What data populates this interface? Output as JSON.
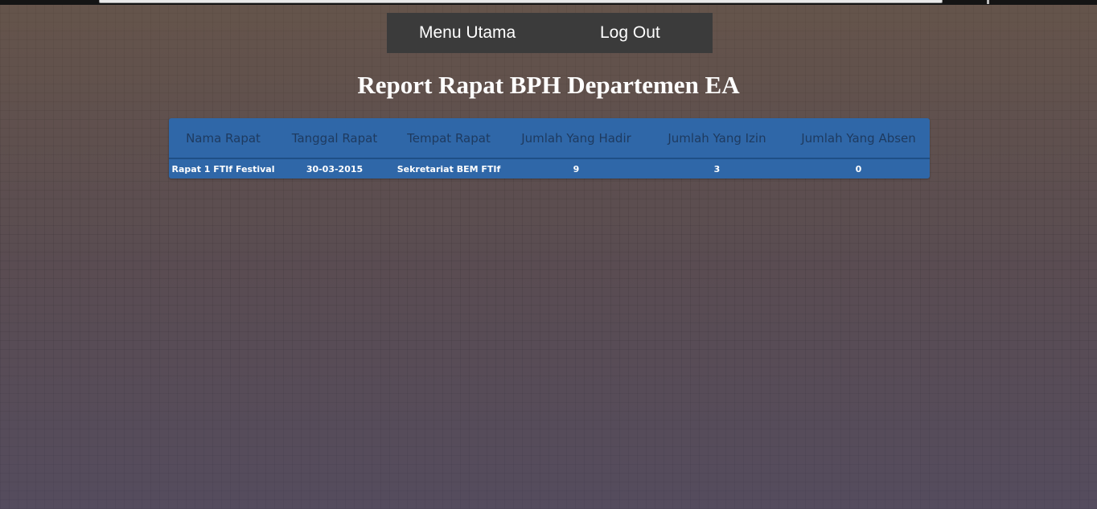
{
  "nav": {
    "menu_utama": "Menu Utama",
    "log_out": "Log Out"
  },
  "page_title": "Report Rapat BPH Departemen EA",
  "table": {
    "headers": [
      "Nama Rapat",
      "Tanggal Rapat",
      "Tempat Rapat",
      "Jumlah Yang Hadir",
      "Jumlah Yang Izin",
      "Jumlah Yang Absen"
    ],
    "rows": [
      [
        "Rapat 1 FTIf Festival",
        "30-03-2015",
        "Sekretariat BEM FTIf",
        "9",
        "3",
        "0"
      ]
    ]
  },
  "colors": {
    "table_background": "#2f67a8",
    "nav_background": "#3b3b3b",
    "header_text": "#1e3a5f"
  }
}
